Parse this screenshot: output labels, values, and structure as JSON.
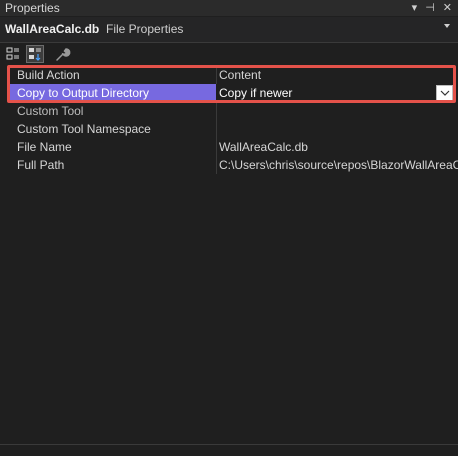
{
  "window": {
    "title": "Properties",
    "icons": [
      "dropdown-icon",
      "pin-icon",
      "close-icon"
    ]
  },
  "object_selector": {
    "name": "WallAreaCalc.db",
    "type": "File Properties"
  },
  "toolbar": {
    "tools": [
      "categorized-icon",
      "alphabetical-icon",
      "property-pages-icon"
    ]
  },
  "properties": [
    {
      "name": "Build Action",
      "value": "Content"
    },
    {
      "name": "Copy to Output Directory",
      "value": "Copy if newer"
    },
    {
      "name": "Custom Tool",
      "value": ""
    },
    {
      "name": "Custom Tool Namespace",
      "value": ""
    },
    {
      "name": "File Name",
      "value": "WallAreaCalc.db"
    },
    {
      "name": "Full Path",
      "value": "C:\\Users\\chris\\source\\repos\\BlazorWallAreaC"
    }
  ],
  "colors": {
    "selection": "#7769e0",
    "highlight_border": "#e4524a",
    "background": "#1f1f1f"
  }
}
